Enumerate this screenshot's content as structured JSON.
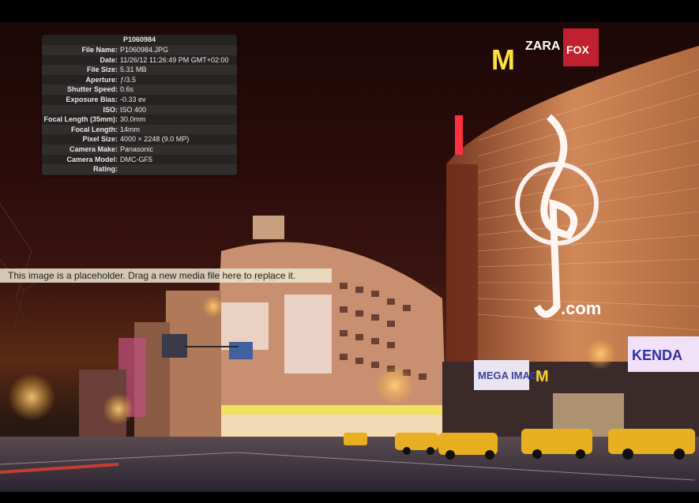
{
  "inspector": {
    "title": "P1060984",
    "rows": [
      {
        "label": "File Name:",
        "value": "P1060984.JPG"
      },
      {
        "label": "Date:",
        "value": "11/26/12 11:26:49 PM GMT+02:00"
      },
      {
        "label": "File Size:",
        "value": "5.31 MB"
      },
      {
        "label": "Aperture:",
        "value": "ƒ/3.5"
      },
      {
        "label": "Shutter Speed:",
        "value": "0.6s"
      },
      {
        "label": "Exposure Bias:",
        "value": "-0.33 ev"
      },
      {
        "label": "ISO:",
        "value": "ISO 400"
      },
      {
        "label": "Focal Length (35mm):",
        "value": "30.0mm"
      },
      {
        "label": "Focal Length:",
        "value": "14mm"
      },
      {
        "label": "Pixel Size:",
        "value": "4000 × 2248 (9.0 MP)"
      },
      {
        "label": "Camera Make:",
        "value": "Panasonic"
      },
      {
        "label": "Camera Model:",
        "value": "DMC-GF5"
      },
      {
        "label": "Rating:",
        "value": ""
      }
    ]
  },
  "placeholder_text": "This image is a placeholder. Drag a new media file here to replace it.",
  "photo": {
    "signs": {
      "mcdonalds_top": "M",
      "zara": "ZARA",
      "fox": "FOX",
      "dotcom": ".com",
      "mega_image": "MEGA IMAGE",
      "kenda": "KENDA"
    },
    "colors": {
      "sky": "#2a0c0a",
      "street_glow": "#ffb040",
      "taxi": "#e8b020"
    }
  }
}
